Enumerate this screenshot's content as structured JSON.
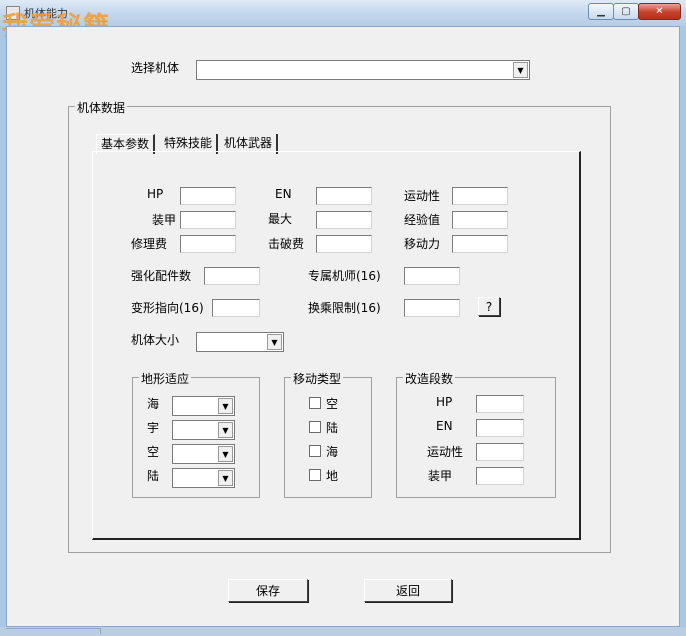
{
  "window": {
    "title": "机体能力",
    "watermark": "我爱秘籍",
    "min_glyph": "▁",
    "max_glyph": "▢",
    "close_glyph": "✕"
  },
  "machine_select": {
    "label": "选择机体",
    "value": ""
  },
  "machine_data": {
    "group_label": "机体数据"
  },
  "tabs": [
    {
      "label": "基本参数",
      "active": true
    },
    {
      "label": "特殊技能",
      "active": false
    },
    {
      "label": "机体武器",
      "active": false
    }
  ],
  "basic": {
    "hp": "HP",
    "en": "EN",
    "mobility": "运动性",
    "armor": "装甲",
    "max_text": "最大",
    "exp": "经验值",
    "repair": "修理费",
    "kill": "击破费",
    "move": "移动力",
    "parts": "强化配件数",
    "pilot": "专属机师(16)",
    "transform": "变形指向(16)",
    "transfer": "换乘限制(16)",
    "help_button": "?",
    "size": "机体大小"
  },
  "terrain": {
    "title": "地形适应",
    "rows": [
      "海",
      "宇",
      "空",
      "陆"
    ]
  },
  "move_type": {
    "title": "移动类型",
    "options": [
      "空",
      "陆",
      "海",
      "地"
    ]
  },
  "upgrade": {
    "title": "改造段数",
    "rows": [
      "HP",
      "EN",
      "运动性",
      "装甲"
    ]
  },
  "buttons": {
    "save": "保存",
    "back": "返回"
  }
}
